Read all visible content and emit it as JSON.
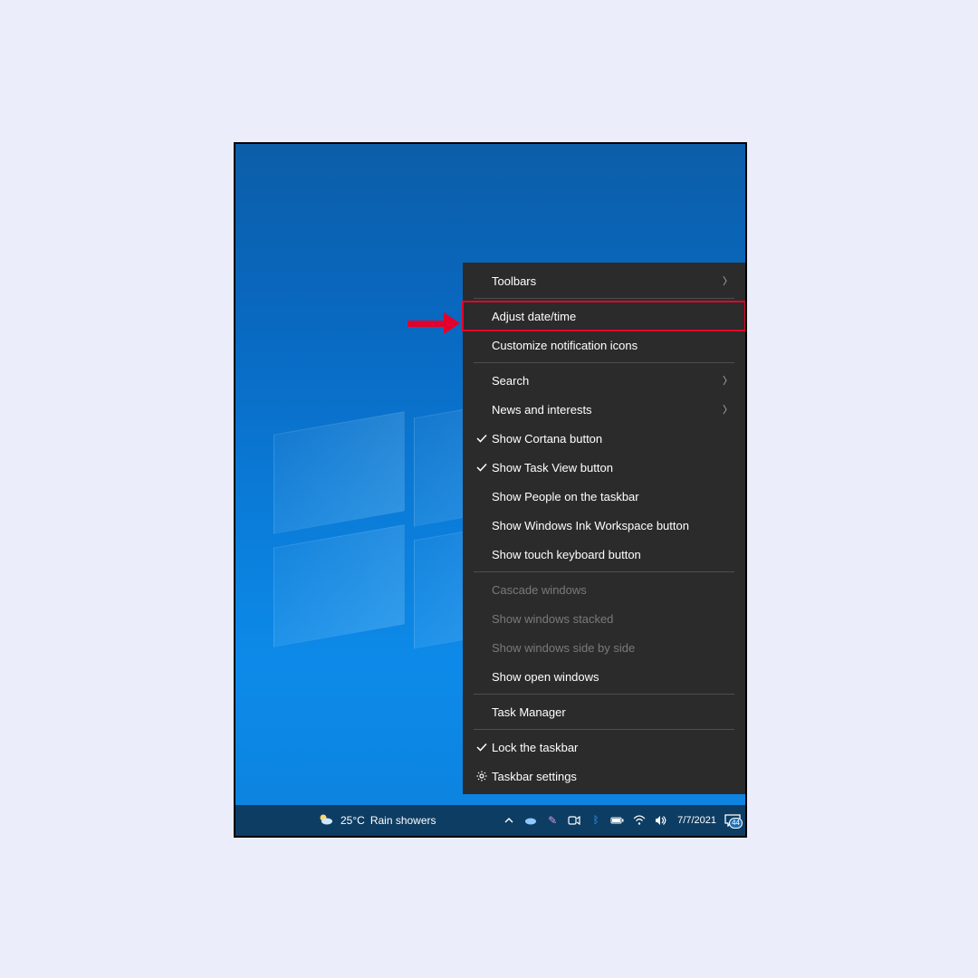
{
  "context_menu": {
    "items": [
      {
        "label": "Toolbars",
        "submenu": true
      },
      {
        "label": "Adjust date/time",
        "highlighted": true
      },
      {
        "label": "Customize notification icons"
      },
      {
        "label": "Search",
        "submenu": true
      },
      {
        "label": "News and interests",
        "submenu": true
      },
      {
        "label": "Show Cortana button",
        "checked": true
      },
      {
        "label": "Show Task View button",
        "checked": true
      },
      {
        "label": "Show People on the taskbar"
      },
      {
        "label": "Show Windows Ink Workspace button"
      },
      {
        "label": "Show touch keyboard button"
      },
      {
        "label": "Cascade windows",
        "disabled": true
      },
      {
        "label": "Show windows stacked",
        "disabled": true
      },
      {
        "label": "Show windows side by side",
        "disabled": true
      },
      {
        "label": "Show open windows"
      },
      {
        "label": "Task Manager"
      },
      {
        "label": "Lock the taskbar",
        "checked": true
      },
      {
        "label": "Taskbar settings",
        "gear": true
      }
    ]
  },
  "taskbar": {
    "weather_temp": "25°C",
    "weather_label": "Rain showers",
    "date": "7/7/2021",
    "action_center_badge": "44"
  }
}
